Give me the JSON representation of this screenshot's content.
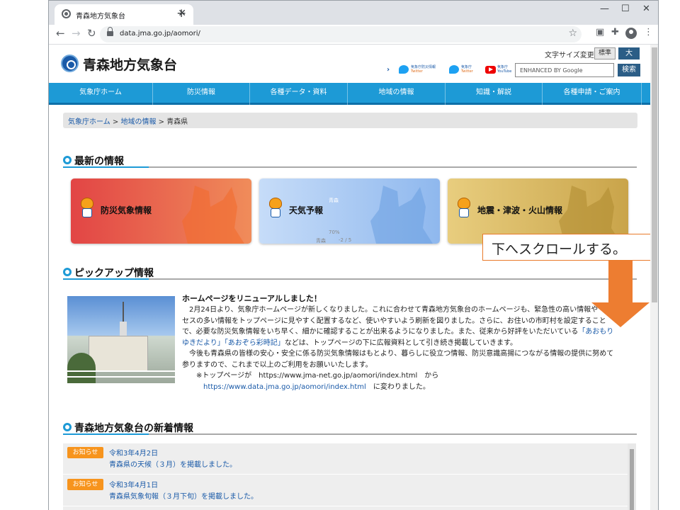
{
  "browser": {
    "tab_title": "青森地方気象台",
    "url": "data.jma.go.jp/aomori/"
  },
  "header": {
    "site_title": "青森地方気象台",
    "font_size_label": "文字サイズ変更",
    "font_size_standard": "標準",
    "font_size_large": "大",
    "search_placeholder": "ENHANCED BY Google",
    "search_button": "検索",
    "sns": [
      {
        "top": "気象庁防災情報",
        "bottom": "Twitter"
      },
      {
        "top": "気象庁",
        "bottom": "Twitter"
      },
      {
        "top": "気象庁",
        "bottom": "YouTube"
      }
    ]
  },
  "nav": [
    "気象庁ホーム",
    "防災情報",
    "各種データ・資料",
    "地域の情報",
    "知識・解説",
    "各種申請・ご案内"
  ],
  "breadcrumb": {
    "home": "気象庁ホーム",
    "sep": " > ",
    "local": "地域の情報",
    "current": "青森県"
  },
  "sections": {
    "latest": "最新の情報",
    "pickup": "ピックアップ情報",
    "news": "青森地方気象台の新着情報"
  },
  "cards": [
    {
      "label": "防災気象情報",
      "color": "#e8524a"
    },
    {
      "label": "天気予報",
      "color": "#8fb8ee"
    },
    {
      "label": "地震・津波・火山情報",
      "color": "#d8b35a"
    }
  ],
  "card_weather_overlay": {
    "place": "青森",
    "pct": "70%",
    "temp": "-2 / 5"
  },
  "callout": "下へスクロールする。",
  "pickup": {
    "title": "ホームページをリニューアルしました！",
    "p1a": "2月24日より、気象庁ホームページが新しくなりました。これに合わせて青森地方気象台のホームページも、緊急性の高い情報や",
    "p1b": "セスの多い情報をトップページに見やすく配置するなど、使いやすいよう刷新を図りました。さらに、お住いの市町村を設定すること",
    "p1c": "で、必要な防災気象情報をいち早く、細かに確認することが出来るようになりました。また、従来から好評をいただいている",
    "link1": "「あおもり",
    "link1b": "ゆきだより」",
    "link2": "「あおぞら彩時記」",
    "p1d": "などは、トップページの下に広報資料として引き続き掲載していきます。",
    "p2a": "今後も青森県の皆様の安心・安全に係る防災気象情報はもとより、暮らしに役立つ情報、防災意識高揚につながる情報の提供に努めて",
    "p2b": "参りますので、これまで以上のご利用をお願いいたします。",
    "p3a": "※トップページが　https://www.jma-net.go.jp/aomori/index.html　から",
    "p3link": "https://www.data.jma.go.jp/aomori/index.html",
    "p3b": "　に変わりました。"
  },
  "news": [
    {
      "badge": "お知らせ",
      "date": "令和3年4月2日",
      "text": "青森県の天候（３月）を掲載しました。"
    },
    {
      "badge": "お知らせ",
      "date": "令和3年4月1日",
      "text": "青森県気象旬報（３月下旬）を掲載しました。"
    }
  ]
}
